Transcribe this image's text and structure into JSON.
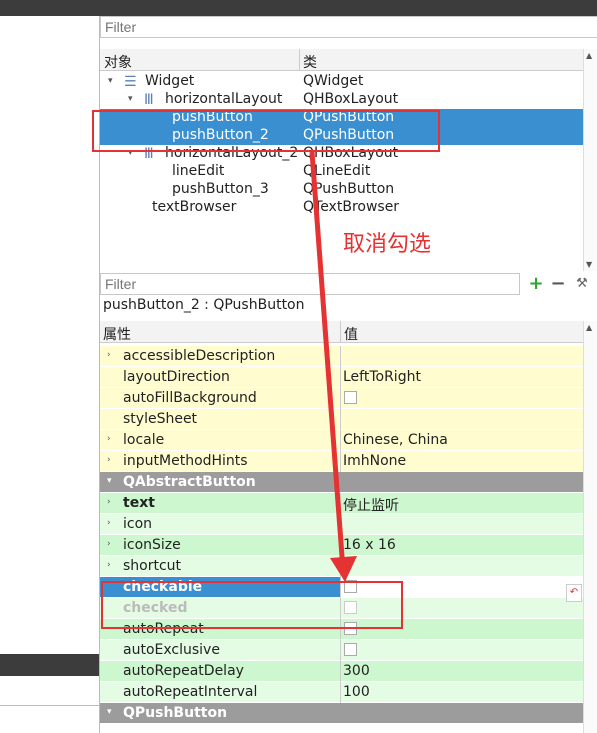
{
  "object_filter": {
    "placeholder": "Filter"
  },
  "object_header": {
    "col1": "对象",
    "col2": "类"
  },
  "tree": [
    {
      "name": "Widget",
      "cls": "QWidget",
      "indent": 0,
      "arrow": "▾",
      "icon": "widget-icon"
    },
    {
      "name": "horizontalLayout",
      "cls": "QHBoxLayout",
      "indent": 1,
      "arrow": "▾",
      "icon": "hbox-layout-icon"
    },
    {
      "name": "pushButton",
      "cls": "QPushButton",
      "indent": 2,
      "arrow": "",
      "icon": "",
      "selected": true
    },
    {
      "name": "pushButton_2",
      "cls": "QPushButton",
      "indent": 2,
      "arrow": "",
      "icon": "",
      "selected": true
    },
    {
      "name": "horizontalLayout_2",
      "cls": "QHBoxLayout",
      "indent": 1,
      "arrow": "▾",
      "icon": "hbox-layout-icon"
    },
    {
      "name": "lineEdit",
      "cls": "QLineEdit",
      "indent": 2,
      "arrow": "",
      "icon": ""
    },
    {
      "name": "pushButton_3",
      "cls": "QPushButton",
      "indent": 2,
      "arrow": "",
      "icon": ""
    },
    {
      "name": "textBrowser",
      "cls": "QTextBrowser",
      "indent": 1,
      "arrow": "",
      "icon": ""
    }
  ],
  "property_filter": {
    "placeholder": "Filter"
  },
  "property_toolbar": {
    "add": "+",
    "remove": "−",
    "wrench": "🔧"
  },
  "object_title": "pushButton_2 : QPushButton",
  "property_header": {
    "col1": "属性",
    "col2": "值"
  },
  "properties": [
    {
      "name": "accessibleDescription",
      "value": "",
      "arrow": "›",
      "style": "y"
    },
    {
      "name": "layoutDirection",
      "value": "LeftToRight",
      "arrow": "",
      "style": "y"
    },
    {
      "name": "autoFillBackground",
      "value": "",
      "arrow": "",
      "style": "y",
      "checkbox": true
    },
    {
      "name": "styleSheet",
      "value": "",
      "arrow": "",
      "style": "y"
    },
    {
      "name": "locale",
      "value": "Chinese, China",
      "arrow": "›",
      "style": "y"
    },
    {
      "name": "inputMethodHints",
      "value": "ImhNone",
      "arrow": "›",
      "style": "y"
    },
    {
      "name": "QAbstractButton",
      "value": "",
      "arrow": "▾",
      "style": "grp"
    },
    {
      "name": "text",
      "value": "停止监听",
      "arrow": "›",
      "style": "g",
      "bold": true
    },
    {
      "name": "icon",
      "value": "",
      "arrow": "›",
      "style": "gl"
    },
    {
      "name": "iconSize",
      "value": "16 x 16",
      "arrow": "›",
      "style": "g"
    },
    {
      "name": "shortcut",
      "value": "",
      "arrow": "›",
      "style": "gl"
    },
    {
      "name": "checkable",
      "value": "",
      "arrow": "",
      "style": "sel",
      "checkbox": true,
      "bold": true
    },
    {
      "name": "checked",
      "value": "",
      "arrow": "",
      "style": "gl",
      "checkbox": true,
      "dim": true,
      "bold": true
    },
    {
      "name": "autoRepeat",
      "value": "",
      "arrow": "",
      "style": "g",
      "checkbox": true
    },
    {
      "name": "autoExclusive",
      "value": "",
      "arrow": "",
      "style": "gl",
      "checkbox": true
    },
    {
      "name": "autoRepeatDelay",
      "value": "300",
      "arrow": "",
      "style": "g"
    },
    {
      "name": "autoRepeatInterval",
      "value": "100",
      "arrow": "",
      "style": "gl"
    },
    {
      "name": "QPushButton",
      "value": "",
      "arrow": "▾",
      "style": "grp"
    }
  ],
  "annotation": {
    "label": "取消勾选",
    "color": "#e53232"
  },
  "colors": {
    "selection": "#3a8fd0",
    "group": "#9c9c9c",
    "yellow": "#fffdd0",
    "green": "#cdf7cf"
  }
}
